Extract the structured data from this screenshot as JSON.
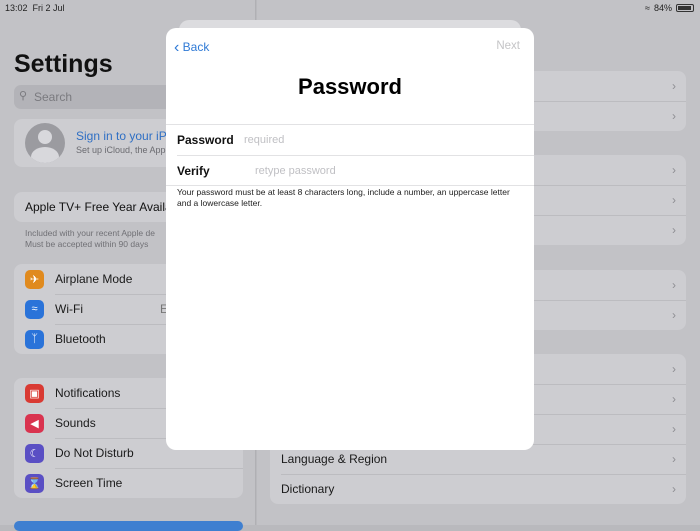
{
  "status": {
    "time": "13:02",
    "date": "Fri 2 Jul",
    "battery": "84%",
    "battery_level": 0.84
  },
  "sidebar": {
    "title": "Settings",
    "search_placeholder": "Search",
    "account": {
      "title": "Sign in to your iPa",
      "subtitle": "Set up iCloud, the App"
    },
    "promo": {
      "title": "Apple TV+ Free Year Availab",
      "note1": "Included with your recent Apple de",
      "note2": "Must be accepted within 90 days"
    },
    "group1": [
      {
        "label": "Airplane Mode",
        "icon": "airplane-icon",
        "color": "#e08a1e",
        "value": ""
      },
      {
        "label": "Wi-Fi",
        "icon": "wifi-icon",
        "color": "#2a73d9",
        "value": "E"
      },
      {
        "label": "Bluetooth",
        "icon": "bluetooth-icon",
        "color": "#2a73d9",
        "value": ""
      }
    ],
    "group2": [
      {
        "label": "Notifications",
        "icon": "notifications-icon",
        "color": "#d93a33"
      },
      {
        "label": "Sounds",
        "icon": "sounds-icon",
        "color": "#d9334f"
      },
      {
        "label": "Do Not Disturb",
        "icon": "moon-icon",
        "color": "#5a4fc4"
      },
      {
        "label": "Screen Time",
        "icon": "hourglass-icon",
        "color": "#5a4fc4"
      }
    ]
  },
  "detail": {
    "rows": [
      "Language & Region",
      "Dictionary"
    ]
  },
  "modal": {
    "back": "Back",
    "next": "Next",
    "title": "Password",
    "password_label": "Password",
    "password_placeholder": "required",
    "verify_label": "Verify",
    "verify_placeholder": "retype password",
    "hint": "Your password must be at least 8 characters long, include a number, an uppercase letter and a lowercase letter."
  }
}
